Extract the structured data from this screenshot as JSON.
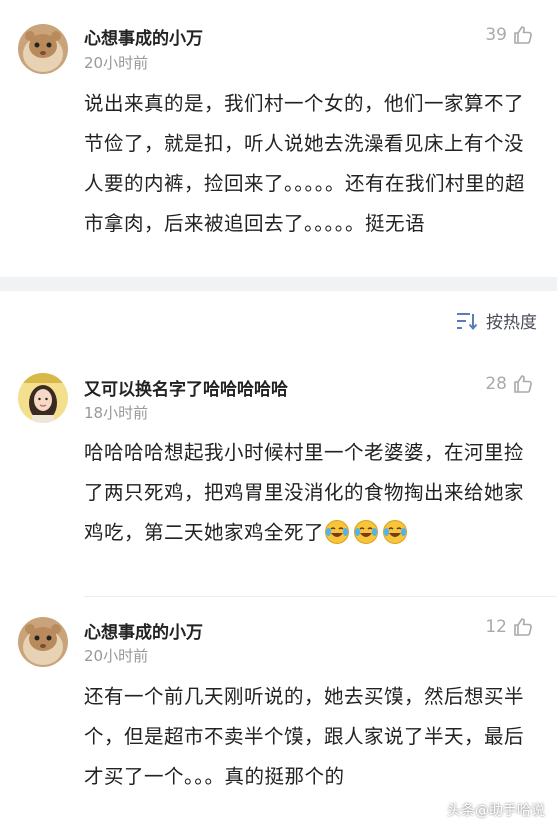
{
  "comments": [
    {
      "username": "心想事成的小万",
      "time": "20小时前",
      "likes": "39",
      "text": "说出来真的是，我们村一个女的，他们一家算不了节俭了，就是扣，听人说她去洗澡看见床上有个没人要的内裤，捡回来了。。。。。还有在我们村里的超市拿肉，后来被追回去了。。。。。挺无语"
    },
    {
      "username": "又可以换名字了哈哈哈哈哈",
      "time": "18小时前",
      "likes": "28",
      "text": "哈哈哈哈想起我小时候村里一个老婆婆，在河里捡了两只死鸡，把鸡胃里没消化的食物掏出来给她家鸡吃，第二天她家鸡全死了"
    },
    {
      "username": "心想事成的小万",
      "time": "20小时前",
      "likes": "12",
      "text": "还有一个前几天刚听说的，她去买馍，然后想买半个，但是超市不卖半个馍，跟人家说了半天，最后才买了一个。。。真的挺那个的"
    }
  ],
  "sort": {
    "label": "按热度",
    "icon": "sort-icon"
  },
  "watermark": "头条@助手哈说",
  "colors": {
    "username": "#222222",
    "time": "#999999",
    "likes": "#aaaaaa",
    "divider": "#f1f2f4"
  }
}
